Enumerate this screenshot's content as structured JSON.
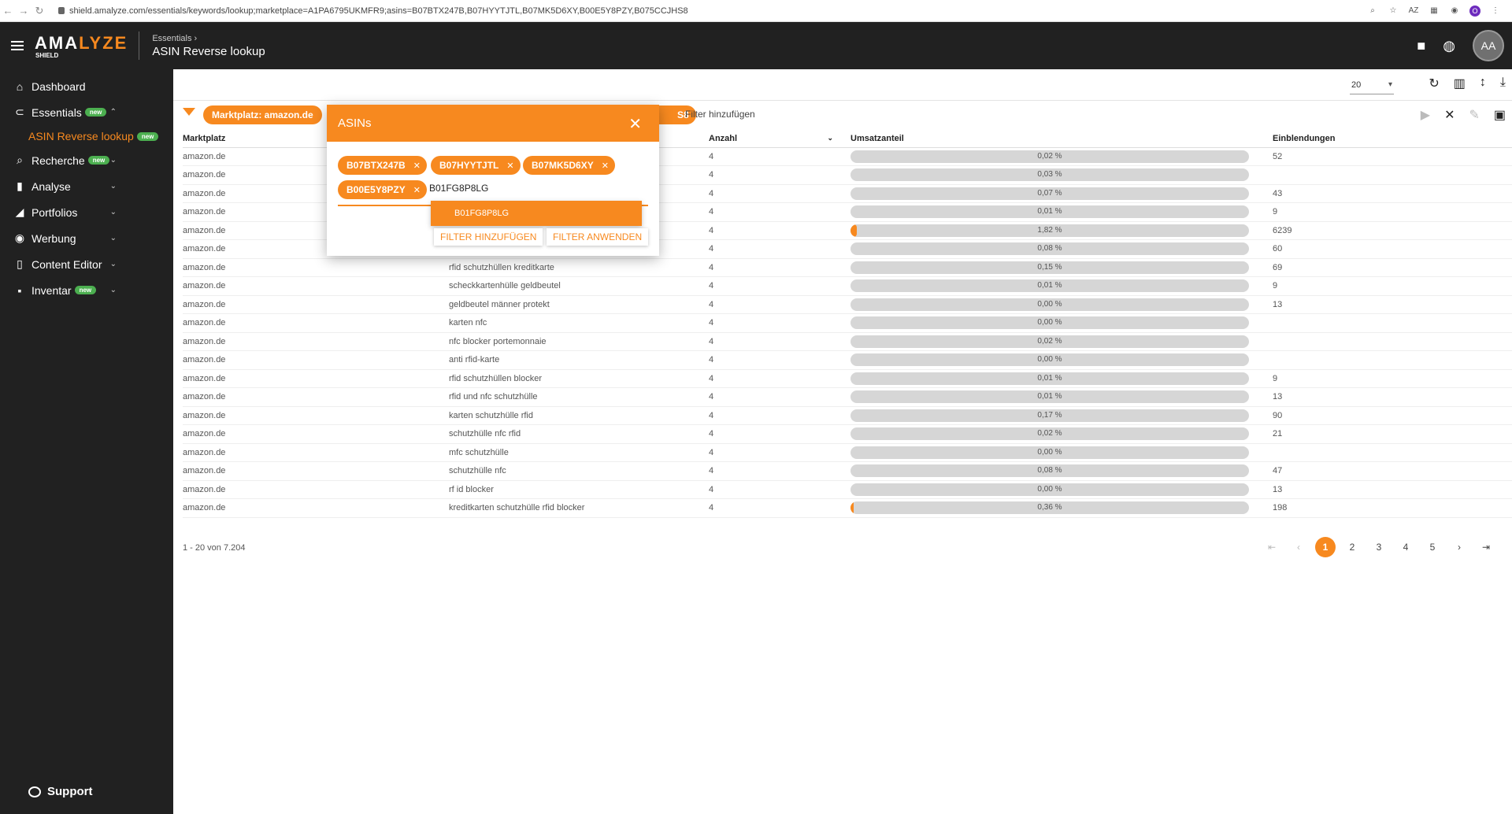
{
  "browser": {
    "url": "shield.amalyze.com/essentials/keywords/lookup;marketplace=A1PA6795UKMFR9;asins=B07BTX247B,B07HYYTJTL,B07MK5D6XY,B00E5Y8PZY,B075CCJHS8"
  },
  "app": {
    "logo_main_a": "AMA",
    "logo_main_b": "LYZE",
    "logo_sub": "SHIELD",
    "crumb_parent": "Essentials ›",
    "crumb_title": "ASIN Reverse lookup",
    "avatar_initials": "AA",
    "accent_color": "#f7891f"
  },
  "sidebar": {
    "items": [
      {
        "label": "Dashboard",
        "icon": "home-icon"
      },
      {
        "label": "Essentials",
        "icon": "essentials-icon",
        "badge": "new"
      },
      {
        "label": "Recherche",
        "icon": "search-icon",
        "badge": "new"
      },
      {
        "label": "Analyse",
        "icon": "analytics-icon"
      },
      {
        "label": "Portfolios",
        "icon": "portfolio-icon"
      },
      {
        "label": "Werbung",
        "icon": "eye-icon"
      },
      {
        "label": "Content Editor",
        "icon": "document-icon"
      },
      {
        "label": "Inventar",
        "icon": "briefcase-icon",
        "badge": "new"
      }
    ],
    "sub_item": {
      "label": "ASIN Reverse lookup",
      "badge": "new"
    },
    "support_label": "Support"
  },
  "toolbar": {
    "page_size": "20"
  },
  "filters": {
    "marketplace_chip": "Marktplatz: amazon.de",
    "hidden_chip_tail": "S8",
    "add_filter_label": "Filter hinzufügen"
  },
  "table": {
    "headers": {
      "marketplace": "Marktplatz",
      "keyword": "",
      "count": "Anzahl",
      "sales_share": "Umsatzanteil",
      "impressions": "Einblendungen"
    },
    "rows": [
      {
        "market": "amazon.de",
        "keyword": "",
        "count": "4",
        "share": 0.02,
        "share_label": "0,02 %",
        "impr": "52"
      },
      {
        "market": "amazon.de",
        "keyword": "",
        "count": "4",
        "share": 0.03,
        "share_label": "0,03 %",
        "impr": ""
      },
      {
        "market": "amazon.de",
        "keyword": "",
        "count": "4",
        "share": 0.07,
        "share_label": "0,07 %",
        "impr": "43"
      },
      {
        "market": "amazon.de",
        "keyword": "",
        "count": "4",
        "share": 0.01,
        "share_label": "0,01 %",
        "impr": "9"
      },
      {
        "market": "amazon.de",
        "keyword": "",
        "count": "4",
        "share": 1.82,
        "share_label": "1,82 %",
        "impr": "6239"
      },
      {
        "market": "amazon.de",
        "keyword": "",
        "count": "4",
        "share": 0.08,
        "share_label": "0,08 %",
        "impr": "60"
      },
      {
        "market": "amazon.de",
        "keyword": "rfid schutzhüllen kreditkarte",
        "count": "4",
        "share": 0.15,
        "share_label": "0,15 %",
        "impr": "69"
      },
      {
        "market": "amazon.de",
        "keyword": "scheckkartenhülle geldbeutel",
        "count": "4",
        "share": 0.01,
        "share_label": "0,01 %",
        "impr": "9"
      },
      {
        "market": "amazon.de",
        "keyword": "geldbeutel männer protekt",
        "count": "4",
        "share": 0.0,
        "share_label": "0,00 %",
        "impr": "13"
      },
      {
        "market": "amazon.de",
        "keyword": "karten nfc",
        "count": "4",
        "share": 0.0,
        "share_label": "0,00 %",
        "impr": ""
      },
      {
        "market": "amazon.de",
        "keyword": "nfc blocker portemonnaie",
        "count": "4",
        "share": 0.02,
        "share_label": "0,02 %",
        "impr": ""
      },
      {
        "market": "amazon.de",
        "keyword": "anti rfid-karte",
        "count": "4",
        "share": 0.0,
        "share_label": "0,00 %",
        "impr": ""
      },
      {
        "market": "amazon.de",
        "keyword": "rfid schutzhüllen blocker",
        "count": "4",
        "share": 0.01,
        "share_label": "0,01 %",
        "impr": "9"
      },
      {
        "market": "amazon.de",
        "keyword": "rfid und nfc schutzhülle",
        "count": "4",
        "share": 0.01,
        "share_label": "0,01 %",
        "impr": "13"
      },
      {
        "market": "amazon.de",
        "keyword": "karten schutzhülle rfid",
        "count": "4",
        "share": 0.17,
        "share_label": "0,17 %",
        "impr": "90"
      },
      {
        "market": "amazon.de",
        "keyword": "schutzhülle nfc rfid",
        "count": "4",
        "share": 0.02,
        "share_label": "0,02 %",
        "impr": "21"
      },
      {
        "market": "amazon.de",
        "keyword": "mfc schutzhülle",
        "count": "4",
        "share": 0.0,
        "share_label": "0,00 %",
        "impr": ""
      },
      {
        "market": "amazon.de",
        "keyword": "schutzhülle nfc",
        "count": "4",
        "share": 0.08,
        "share_label": "0,08 %",
        "impr": "47"
      },
      {
        "market": "amazon.de",
        "keyword": "rf id blocker",
        "count": "4",
        "share": 0.0,
        "share_label": "0,00 %",
        "impr": "13"
      },
      {
        "market": "amazon.de",
        "keyword": "kreditkarten schutzhülle rfid blocker",
        "count": "4",
        "share": 0.36,
        "share_label": "0,36 %",
        "impr": "198"
      }
    ]
  },
  "pagination": {
    "range_label": "1 - 20 von 7.204",
    "pages": [
      "1",
      "2",
      "3",
      "4",
      "5"
    ],
    "current": "1"
  },
  "dialog": {
    "title": "ASINs",
    "chips": [
      "B07BTX247B",
      "B07HYYTJTL",
      "B07MK5D6XY",
      "B00E5Y8PZY"
    ],
    "input_value": "B01FG8P8LG",
    "suggestion": "B01FG8P8LG",
    "add_button": "FILTER HINZUFÜGEN",
    "apply_button": "FILTER ANWENDEN"
  }
}
